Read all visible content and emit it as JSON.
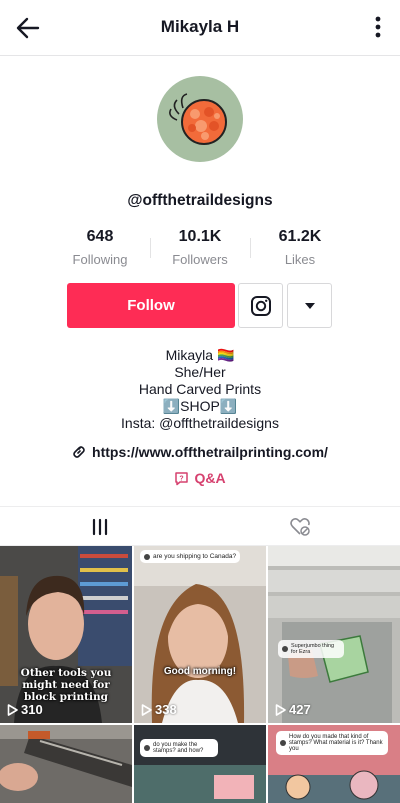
{
  "header": {
    "title": "Mikayla H",
    "back_icon": "arrow-left-icon",
    "more_icon": "more-vertical-icon"
  },
  "profile": {
    "handle": "@offthetraildesigns",
    "avatar_icon": "orange-stamp-logo",
    "avatar_bg": "#a7bfa2"
  },
  "stats": [
    {
      "value": "648",
      "label": "Following"
    },
    {
      "value": "10.1K",
      "label": "Followers"
    },
    {
      "value": "61.2K",
      "label": "Likes"
    }
  ],
  "actions": {
    "follow_label": "Follow",
    "follow_color": "#fe2c55",
    "instagram_icon": "instagram-icon",
    "dropdown_icon": "caret-down-icon"
  },
  "bio": {
    "lines": [
      "Mikayla 🏳️‍🌈",
      "She/Her",
      "Hand Carved Prints",
      "⬇️SHOP⬇️",
      "Insta: @offthetraildesigns"
    ],
    "link": "https://www.offthetrailprinting.com/",
    "qa_label": "Q&A",
    "qa_color": "#d6416f"
  },
  "tabs": [
    {
      "name": "videos",
      "icon": "grid-bars-icon",
      "active": true
    },
    {
      "name": "liked",
      "icon": "heart-eye-hidden-icon",
      "active": false
    }
  ],
  "videos": [
    {
      "views": "310",
      "caption": "Other tools you might need for block printing"
    },
    {
      "views": "338",
      "caption": "Good morning!",
      "sticker": "are you shipping to Canada?"
    },
    {
      "views": "427",
      "sticker": "Superjumbo thing for Ezra"
    },
    {
      "views": ""
    },
    {
      "views": "",
      "sticker": "do you make the stamps? and how?"
    },
    {
      "views": "",
      "sticker": "How do you made that kind of stamps? What material is it? Thank you"
    }
  ]
}
